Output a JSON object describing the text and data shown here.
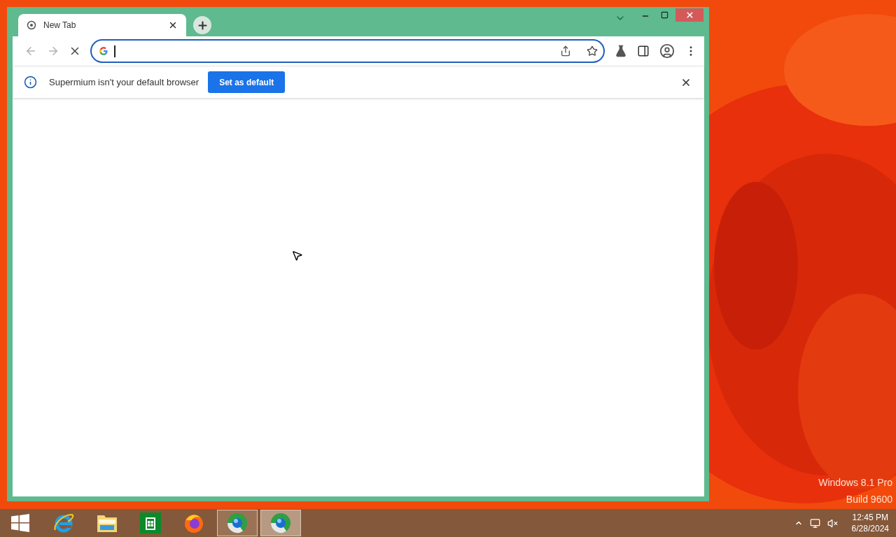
{
  "browser": {
    "tabs": [
      {
        "title": "New Tab",
        "selected": true
      }
    ],
    "navigation": [
      {
        "kind": "back",
        "disabled": true
      },
      {
        "kind": "forward",
        "disabled": true
      },
      {
        "kind": "stop",
        "disabled": false
      }
    ],
    "infobar": {
      "message": "Supermium isn't your default browser",
      "button": "Set as default"
    }
  },
  "desktop": {
    "watermark": [
      "Windows 8.1 Pro",
      "Build 9600"
    ]
  },
  "taskbar": {
    "apps": [
      {
        "kind": "start",
        "open": false,
        "active": false
      },
      {
        "kind": "ie",
        "open": false,
        "active": false
      },
      {
        "kind": "explorer",
        "open": false,
        "active": false
      },
      {
        "kind": "store",
        "open": false,
        "active": false
      },
      {
        "kind": "firefox",
        "open": false,
        "active": false
      },
      {
        "kind": "browser",
        "open": true,
        "active": false
      },
      {
        "kind": "browser",
        "open": true,
        "active": true
      }
    ],
    "clock": {
      "time": "12:45 PM",
      "date": "6/28/2024"
    }
  }
}
